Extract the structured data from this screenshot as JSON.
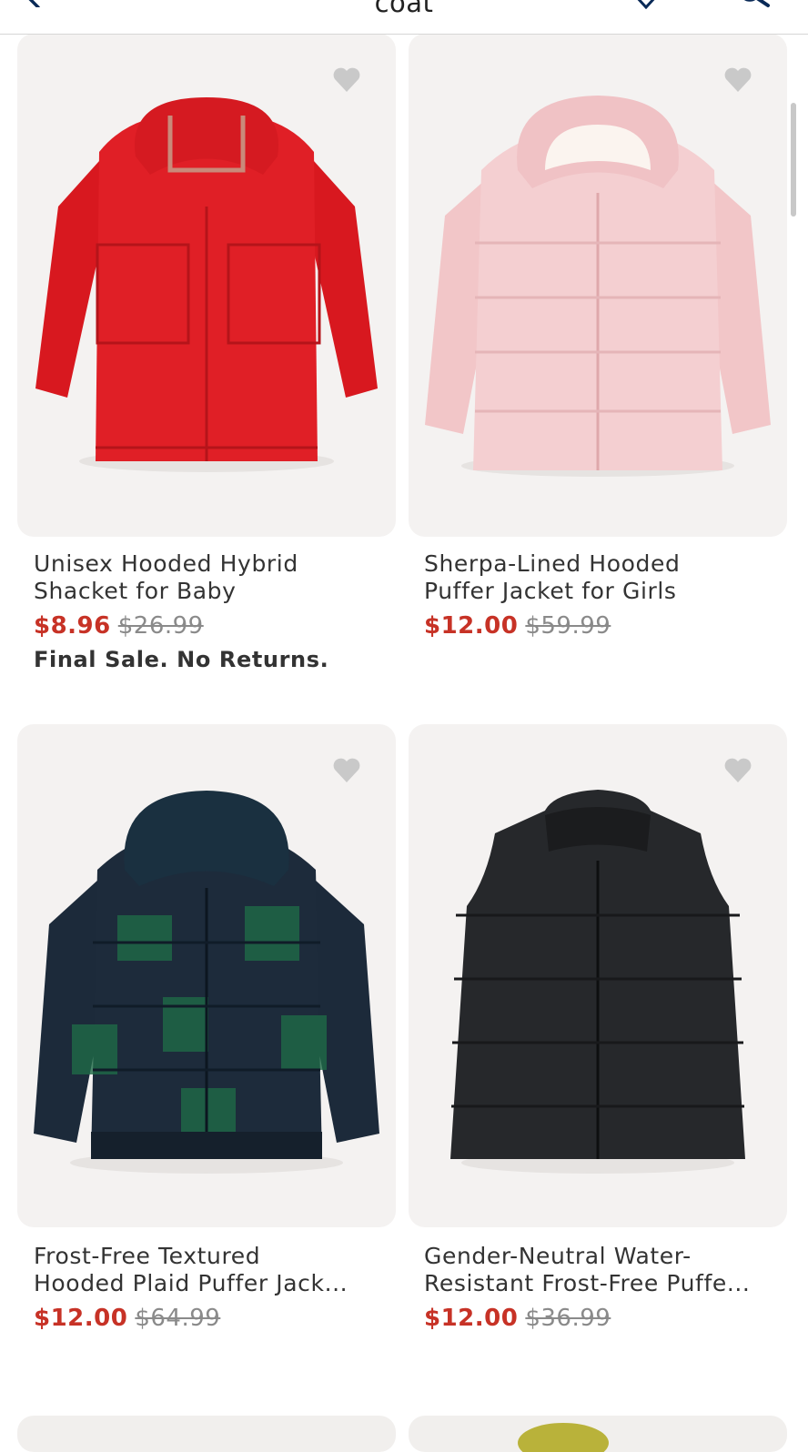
{
  "header": {
    "title": "coat",
    "back_icon": "chevron-left-icon",
    "wishlist_icon": "heart-outline-icon",
    "search_icon": "search-icon",
    "accent_color": "#0a2a57"
  },
  "colors": {
    "sale": "#c73226",
    "original": "#8a8a8a",
    "card_bg": "#f4f2f1"
  },
  "products": [
    {
      "name_line1": "Unisex Hooded Hybrid",
      "name_line2": "Shacket for Baby",
      "sale_price": "$8.96",
      "original_price": "$26.99",
      "note": "Final Sale. No Returns.",
      "image": "red hooded jacket"
    },
    {
      "name_line1": "Sherpa-Lined Hooded",
      "name_line2": "Puffer Jacket for Girls",
      "sale_price": "$12.00",
      "original_price": "$59.99",
      "image": "pink puffer jacket"
    },
    {
      "name_line1": "Frost-Free Textured",
      "name_line2": "Hooded Plaid Puffer Jack...",
      "sale_price": "$12.00",
      "original_price": "$64.99",
      "image": "green plaid puffer jacket"
    },
    {
      "name_line1": "Gender-Neutral Water-",
      "name_line2": "Resistant Frost-Free Puffe...",
      "sale_price": "$12.00",
      "original_price": "$36.99",
      "image": "black puffer vest"
    }
  ]
}
